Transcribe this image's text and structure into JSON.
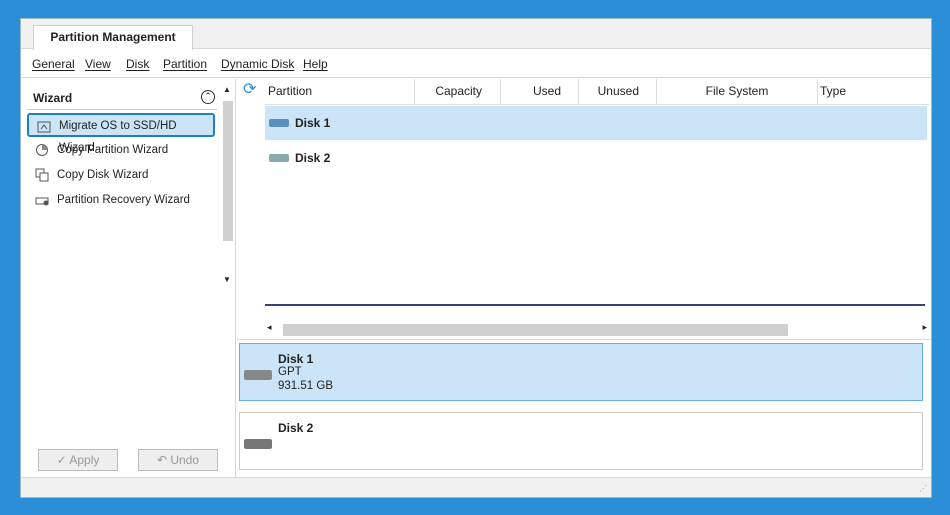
{
  "tab": {
    "title": "Partition Management"
  },
  "menu": [
    "General",
    "View",
    "Disk",
    "Partition",
    "Dynamic Disk",
    "Help"
  ],
  "sidebar": {
    "title": "Wizard",
    "items": [
      {
        "label": "Migrate OS to SSD/HD Wizard",
        "icon": "migrate-icon",
        "selected": true
      },
      {
        "label": "Copy Partition Wizard",
        "icon": "copy-partition-icon"
      },
      {
        "label": "Copy Disk Wizard",
        "icon": "copy-disk-icon"
      },
      {
        "label": "Partition Recovery Wizard",
        "icon": "recovery-icon"
      }
    ],
    "apply_label": "Apply",
    "undo_label": "Undo"
  },
  "grid": {
    "columns": [
      "Partition",
      "Capacity",
      "Used",
      "Unused",
      "File System",
      "Type"
    ],
    "rows": [
      {
        "label": "Disk 1",
        "selected": true
      },
      {
        "label": "Disk 2"
      }
    ]
  },
  "disk_map": [
    {
      "name": "Disk 1",
      "style": "GPT",
      "size": "931.51 GB",
      "selected": true
    },
    {
      "name": "Disk 2"
    }
  ],
  "colors": {
    "accent": "#1e7ec8",
    "selection": "#cce4f7",
    "frame": "#2a8fd8"
  }
}
